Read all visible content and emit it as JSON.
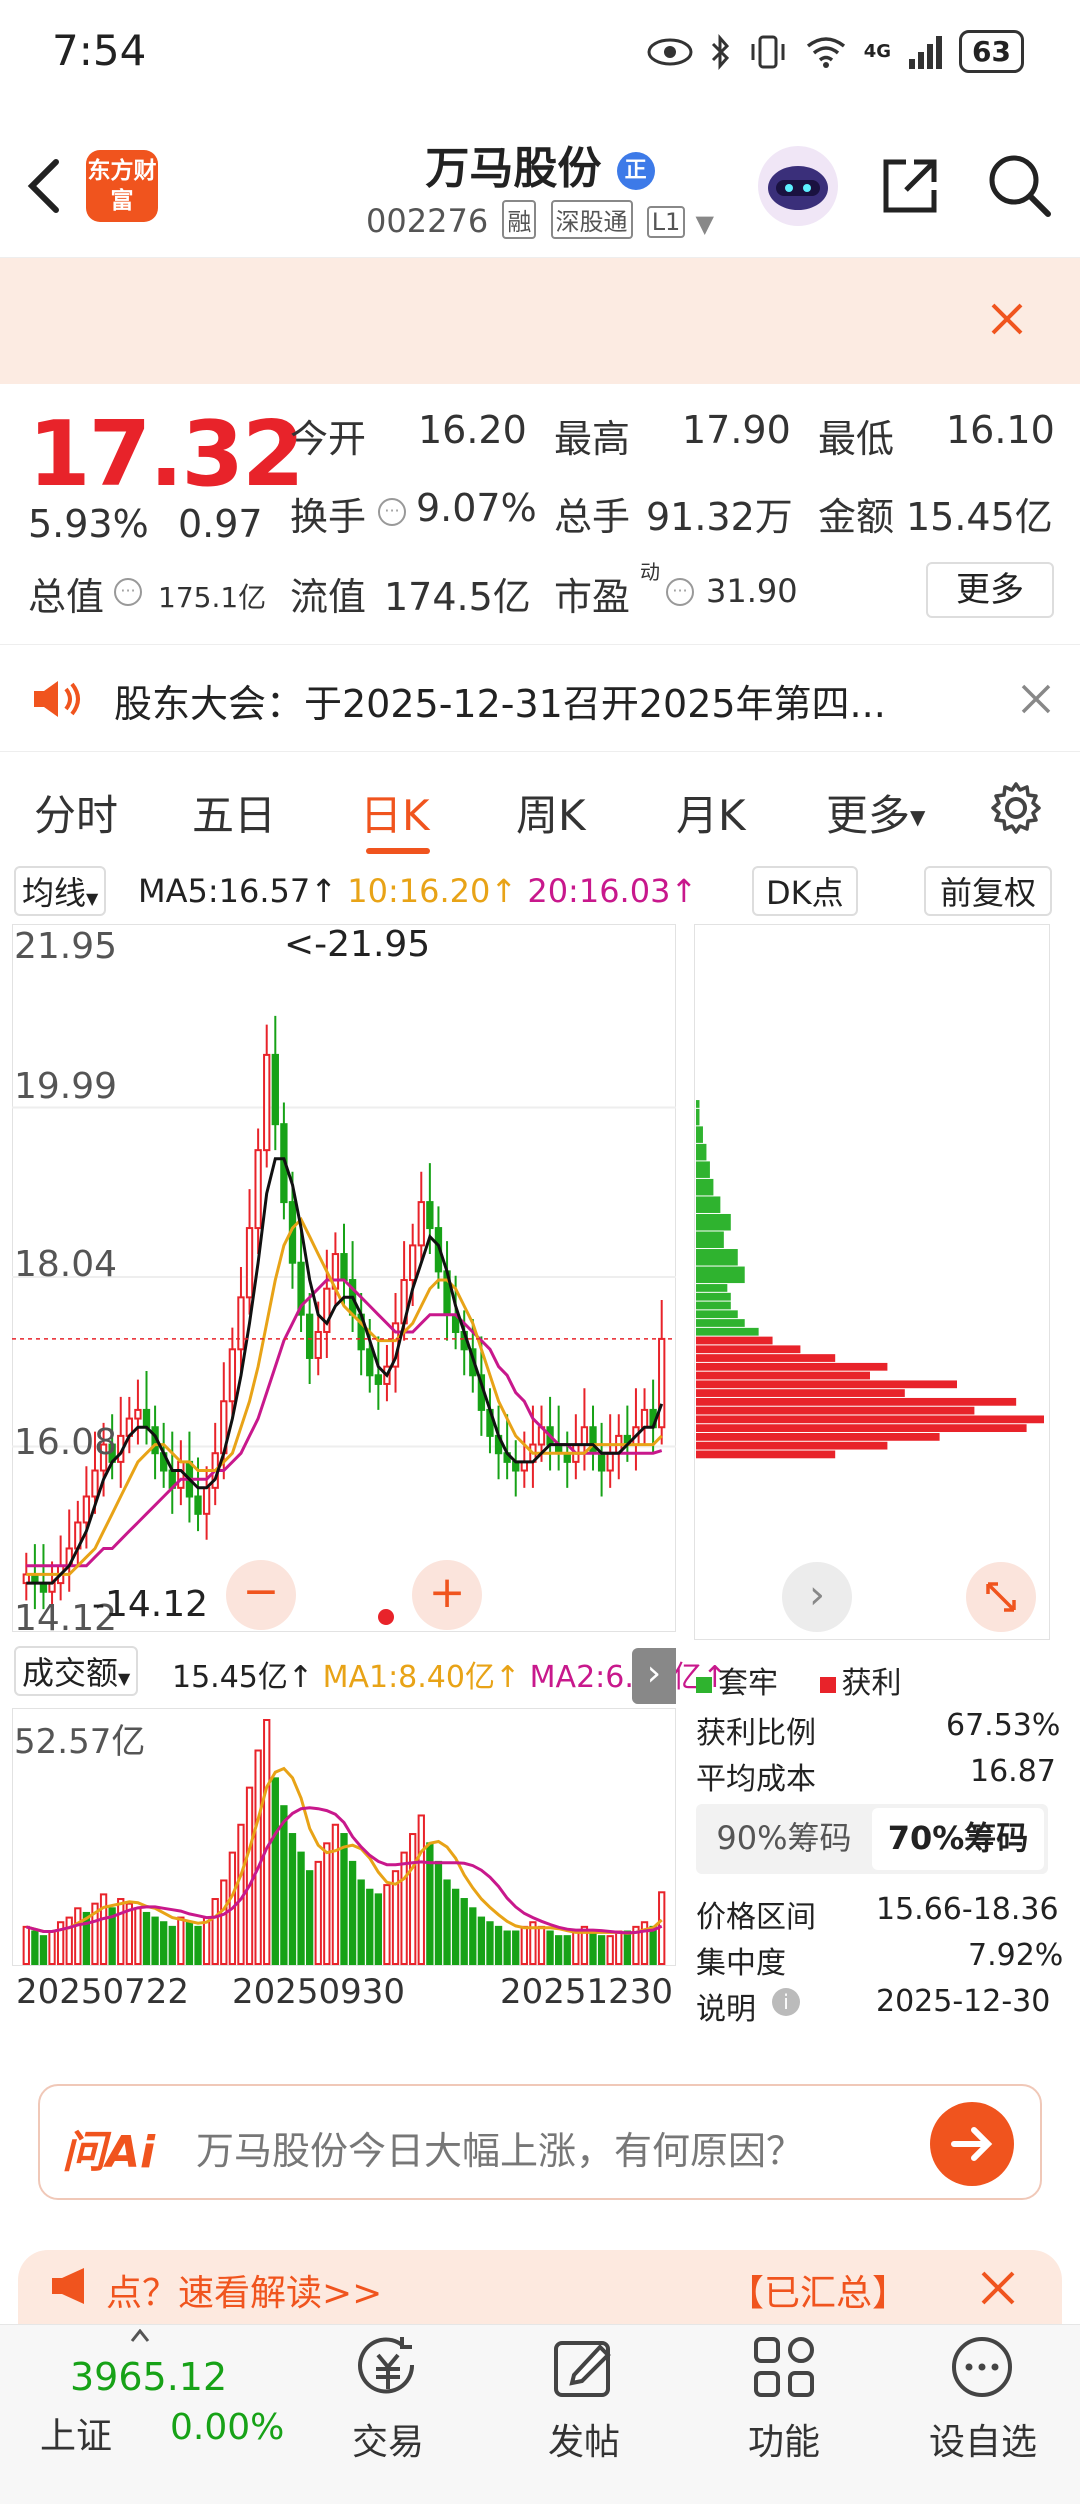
{
  "status": {
    "time": "7:54",
    "network": "4G",
    "battery": "63"
  },
  "header": {
    "app_logo_text": "东方财富",
    "stock_name": "万马股份",
    "name_badge": "正",
    "stock_code": "002276",
    "tags": [
      "融",
      "深股通",
      "L1"
    ]
  },
  "quote": {
    "price": "17.32",
    "change_pct": "5.93%",
    "change": "0.97",
    "total_value_label": "总值",
    "total_value": "175.1亿",
    "open_label": "今开",
    "open": "16.20",
    "high_label": "最高",
    "high": "17.90",
    "low_label": "最低",
    "low": "16.10",
    "turnover_label": "换手",
    "turnover": "9.07%",
    "volume_label": "总手",
    "volume": "91.32万",
    "amount_label": "金额",
    "amount": "15.45亿",
    "float_value_label": "流值",
    "float_value": "174.5亿",
    "pe_label": "市盈",
    "pe_sup": "动",
    "pe": "31.90",
    "more_label": "更多"
  },
  "notice": {
    "text": "股东大会：于2025-12-31召开2025年第四..."
  },
  "tabs": {
    "items": [
      "分时",
      "五日",
      "日K",
      "周K",
      "月K",
      "更多"
    ],
    "active": "日K"
  },
  "kline": {
    "ma_selector": "均线",
    "ma5": "MA5:16.57↑",
    "ma10": "10:16.20↑",
    "ma20": "20:16.03↑",
    "dk_label": "DK点",
    "adjust_label": "前复权",
    "y_labels": [
      "21.95",
      "19.99",
      "18.04",
      "16.08",
      "14.12"
    ],
    "max_label": "<-21.95",
    "min_label": "-14.12",
    "volume_selector": "成交额",
    "vol_value": "15.45亿↑",
    "vol_ma1": "MA1:8.40亿↑",
    "vol_ma2": "MA2:6.38亿↑",
    "vol_max": "52.57亿",
    "dates": [
      "20250722",
      "20250930",
      "20251230"
    ]
  },
  "chip": {
    "legend_locked": "套牢",
    "legend_profit": "获利",
    "profit_ratio_label": "获利比例",
    "profit_ratio": "67.53%",
    "avg_cost_label": "平均成本",
    "avg_cost": "16.87",
    "tab90": "90%筹码",
    "tab70": "70%筹码",
    "range_label": "价格区间",
    "range": "15.66-18.36",
    "concentration_label": "集中度",
    "concentration": "7.92%",
    "note_label": "说明",
    "note_date": "2025-12-30"
  },
  "ai": {
    "brand": "问Ai",
    "prompt": "万马股份今日大幅上涨，有何原因？"
  },
  "promo": {
    "left_text": "点？速看解读>>",
    "right_text": "【已汇总】"
  },
  "navbar": {
    "index_value": "3965.12",
    "index_name": "上证",
    "index_change": "0.00%",
    "items": [
      "交易",
      "发帖",
      "功能",
      "设自选"
    ]
  },
  "colors": {
    "up": "#e8232a",
    "down": "#17a217",
    "accent": "#f0541e",
    "ma5": "#111111",
    "ma10": "#e8a317",
    "ma20": "#c8188c",
    "sell_marker": "#3d8ee8"
  },
  "chart_data": {
    "type": "candlestick",
    "title": "",
    "ylim": [
      14.12,
      21.95
    ],
    "price_series": {
      "close": [
        14.6,
        14.5,
        14.4,
        14.5,
        14.7,
        14.9,
        15.2,
        15.5,
        15.8,
        16.1,
        15.9,
        16.2,
        16.4,
        16.5,
        16.3,
        16.0,
        15.8,
        15.6,
        15.9,
        15.5,
        15.3,
        15.6,
        16.0,
        16.6,
        17.2,
        17.8,
        18.6,
        19.5,
        20.6,
        19.8,
        18.9,
        18.2,
        17.6,
        17.1,
        17.4,
        17.9,
        18.3,
        18.0,
        17.6,
        17.2,
        16.9,
        16.8,
        17.0,
        17.5,
        18.0,
        18.4,
        18.9,
        18.6,
        18.1,
        17.6,
        17.4,
        17.2,
        16.9,
        16.5,
        16.2,
        16.0,
        15.9,
        15.8,
        15.9,
        16.1,
        16.3,
        16.1,
        16.0,
        15.9,
        16.1,
        16.3,
        16.0,
        15.8,
        16.0,
        16.2,
        16.1,
        16.3,
        16.5,
        16.3,
        17.32
      ],
      "ma5": [
        14.5,
        14.5,
        14.5,
        14.5,
        14.6,
        14.7,
        14.9,
        15.1,
        15.4,
        15.7,
        15.9,
        16.0,
        16.2,
        16.3,
        16.3,
        16.2,
        16.0,
        15.8,
        15.8,
        15.7,
        15.6,
        15.6,
        15.7,
        16.0,
        16.4,
        16.9,
        17.5,
        18.2,
        19.0,
        19.4,
        19.4,
        19.1,
        18.6,
        18.0,
        17.6,
        17.5,
        17.7,
        17.8,
        17.8,
        17.6,
        17.3,
        17.0,
        16.9,
        17.1,
        17.5,
        17.9,
        18.2,
        18.5,
        18.4,
        18.1,
        17.7,
        17.4,
        17.1,
        16.8,
        16.5,
        16.2,
        16.0,
        15.9,
        15.9,
        15.9,
        16.0,
        16.1,
        16.1,
        16.1,
        16.1,
        16.1,
        16.1,
        16.0,
        16.0,
        16.0,
        16.1,
        16.2,
        16.3,
        16.3,
        16.57
      ],
      "ma10": [
        14.6,
        14.6,
        14.6,
        14.6,
        14.6,
        14.6,
        14.7,
        14.8,
        14.9,
        15.1,
        15.3,
        15.5,
        15.7,
        15.9,
        16.0,
        16.1,
        16.1,
        16.0,
        15.9,
        15.9,
        15.8,
        15.8,
        15.8,
        15.9,
        16.0,
        16.3,
        16.6,
        17.0,
        17.5,
        18.0,
        18.4,
        18.6,
        18.7,
        18.5,
        18.3,
        18.1,
        17.9,
        17.7,
        17.6,
        17.5,
        17.4,
        17.3,
        17.3,
        17.3,
        17.4,
        17.5,
        17.7,
        17.9,
        18.0,
        18.0,
        17.9,
        17.7,
        17.5,
        17.2,
        16.9,
        16.6,
        16.4,
        16.2,
        16.1,
        16.0,
        16.0,
        16.0,
        16.0,
        16.0,
        16.0,
        16.0,
        16.1,
        16.1,
        16.1,
        16.1,
        16.1,
        16.1,
        16.1,
        16.1,
        16.2
      ],
      "ma20": [
        14.7,
        14.7,
        14.7,
        14.7,
        14.7,
        14.7,
        14.7,
        14.7,
        14.8,
        14.9,
        14.9,
        15.0,
        15.1,
        15.2,
        15.3,
        15.4,
        15.5,
        15.6,
        15.7,
        15.7,
        15.7,
        15.7,
        15.8,
        15.8,
        15.9,
        16.0,
        16.2,
        16.4,
        16.7,
        17.0,
        17.3,
        17.5,
        17.7,
        17.8,
        17.9,
        18.0,
        18.0,
        18.0,
        17.9,
        17.8,
        17.7,
        17.6,
        17.5,
        17.4,
        17.4,
        17.4,
        17.5,
        17.6,
        17.6,
        17.6,
        17.6,
        17.5,
        17.4,
        17.3,
        17.2,
        17.0,
        16.9,
        16.7,
        16.6,
        16.4,
        16.3,
        16.2,
        16.1,
        16.1,
        16.0,
        16.0,
        16.0,
        16.0,
        16.0,
        16.0,
        16.0,
        16.0,
        16.0,
        16.0,
        16.03
      ]
    },
    "volume_series": {
      "values": [
        8,
        7,
        6,
        7,
        9,
        10,
        12,
        11,
        13,
        15,
        12,
        14,
        13,
        12,
        11,
        10,
        9,
        8,
        10,
        9,
        8,
        10,
        14,
        18,
        24,
        30,
        38,
        46,
        52.57,
        40,
        34,
        28,
        24,
        20,
        22,
        26,
        30,
        28,
        22,
        18,
        16,
        15,
        17,
        20,
        24,
        28,
        32,
        26,
        22,
        18,
        16,
        14,
        12,
        10,
        9,
        8,
        7,
        7,
        8,
        9,
        8,
        7,
        6,
        6,
        7,
        8,
        7,
        6,
        6,
        7,
        7,
        8,
        9,
        8,
        15.45
      ],
      "up": [
        1,
        0,
        0,
        1,
        1,
        1,
        1,
        0,
        1,
        1,
        0,
        1,
        1,
        1,
        0,
        0,
        0,
        0,
        1,
        0,
        0,
        1,
        1,
        1,
        1,
        1,
        1,
        1,
        1,
        0,
        0,
        0,
        0,
        0,
        1,
        1,
        1,
        0,
        0,
        0,
        0,
        0,
        1,
        1,
        1,
        1,
        1,
        0,
        0,
        0,
        0,
        0,
        0,
        0,
        0,
        0,
        0,
        0,
        1,
        1,
        1,
        0,
        0,
        0,
        1,
        1,
        0,
        0,
        1,
        1,
        0,
        1,
        1,
        0,
        1
      ],
      "ma1_last": "8.40亿",
      "ma2_last": "6.38亿",
      "ylim": [
        0,
        52.57
      ]
    },
    "chip_distribution": {
      "price_levels": [
        16.0,
        16.1,
        16.2,
        16.3,
        16.4,
        16.5,
        16.6,
        16.7,
        16.8,
        16.9,
        17.0,
        17.1,
        17.2,
        17.3,
        17.4,
        17.5,
        17.6,
        17.7,
        17.8,
        17.9,
        18.0,
        18.2,
        18.4,
        18.6,
        18.8,
        19.0,
        19.2,
        19.4,
        19.6,
        19.8,
        20.0
      ],
      "weights": [
        40,
        55,
        70,
        95,
        100,
        80,
        92,
        60,
        75,
        50,
        55,
        40,
        30,
        22,
        18,
        14,
        12,
        10,
        10,
        9,
        14,
        12,
        8,
        10,
        7,
        5,
        4,
        3,
        2,
        1,
        1
      ],
      "current_price": 17.32
    },
    "x_labels": [
      "20250722",
      "20250930",
      "20251230"
    ]
  }
}
